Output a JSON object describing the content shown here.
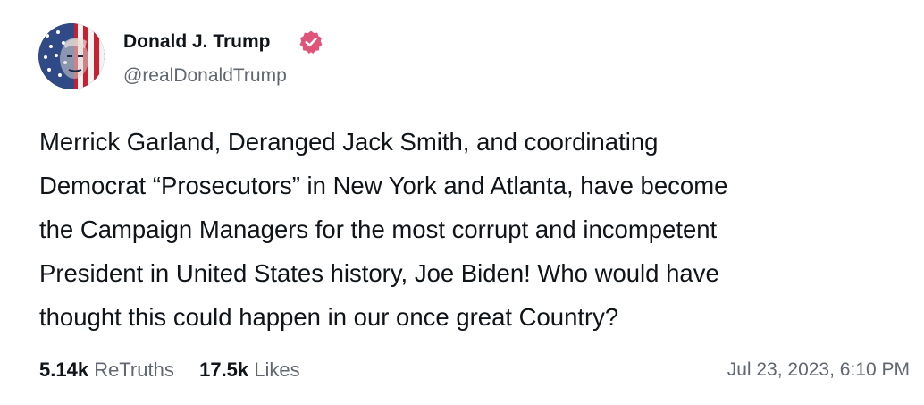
{
  "author": {
    "display_name": "Donald J. Trump",
    "handle": "@realDonaldTrump",
    "verified": true,
    "verified_badge_color": "#e0547a",
    "avatar_icon": "profile-avatar"
  },
  "post": {
    "text_lines": [
      "Merrick Garland, Deranged Jack Smith, and coordinating",
      "Democrat “Prosecutors” in New York and Atlanta, have become",
      "the Campaign Managers for the most corrupt and incompetent",
      "President in United States history, Joe Biden! Who would have",
      "thought this could happen in our once great Country?"
    ]
  },
  "stats": {
    "retruths_count": "5.14k",
    "retruths_label": "ReTruths",
    "likes_count": "17.5k",
    "likes_label": "Likes"
  },
  "timestamp": "Jul 23, 2023, 6:10 PM"
}
